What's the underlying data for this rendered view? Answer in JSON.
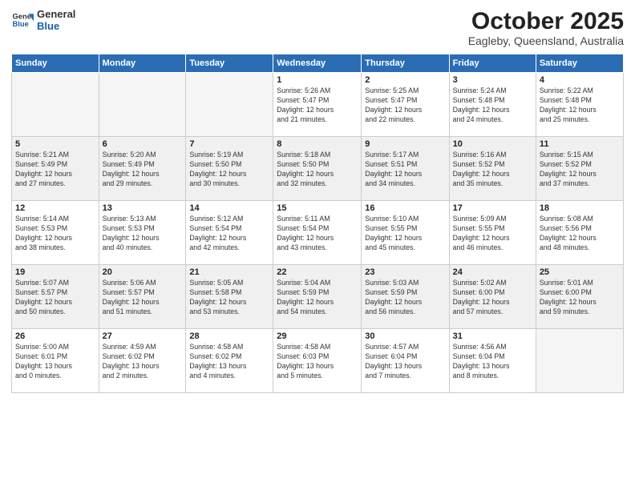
{
  "header": {
    "logo_line1": "General",
    "logo_line2": "Blue",
    "month": "October 2025",
    "location": "Eagleby, Queensland, Australia"
  },
  "weekdays": [
    "Sunday",
    "Monday",
    "Tuesday",
    "Wednesday",
    "Thursday",
    "Friday",
    "Saturday"
  ],
  "weeks": [
    [
      {
        "day": "",
        "info": ""
      },
      {
        "day": "",
        "info": ""
      },
      {
        "day": "",
        "info": ""
      },
      {
        "day": "1",
        "info": "Sunrise: 5:26 AM\nSunset: 5:47 PM\nDaylight: 12 hours\nand 21 minutes."
      },
      {
        "day": "2",
        "info": "Sunrise: 5:25 AM\nSunset: 5:47 PM\nDaylight: 12 hours\nand 22 minutes."
      },
      {
        "day": "3",
        "info": "Sunrise: 5:24 AM\nSunset: 5:48 PM\nDaylight: 12 hours\nand 24 minutes."
      },
      {
        "day": "4",
        "info": "Sunrise: 5:22 AM\nSunset: 5:48 PM\nDaylight: 12 hours\nand 25 minutes."
      }
    ],
    [
      {
        "day": "5",
        "info": "Sunrise: 5:21 AM\nSunset: 5:49 PM\nDaylight: 12 hours\nand 27 minutes."
      },
      {
        "day": "6",
        "info": "Sunrise: 5:20 AM\nSunset: 5:49 PM\nDaylight: 12 hours\nand 29 minutes."
      },
      {
        "day": "7",
        "info": "Sunrise: 5:19 AM\nSunset: 5:50 PM\nDaylight: 12 hours\nand 30 minutes."
      },
      {
        "day": "8",
        "info": "Sunrise: 5:18 AM\nSunset: 5:50 PM\nDaylight: 12 hours\nand 32 minutes."
      },
      {
        "day": "9",
        "info": "Sunrise: 5:17 AM\nSunset: 5:51 PM\nDaylight: 12 hours\nand 34 minutes."
      },
      {
        "day": "10",
        "info": "Sunrise: 5:16 AM\nSunset: 5:52 PM\nDaylight: 12 hours\nand 35 minutes."
      },
      {
        "day": "11",
        "info": "Sunrise: 5:15 AM\nSunset: 5:52 PM\nDaylight: 12 hours\nand 37 minutes."
      }
    ],
    [
      {
        "day": "12",
        "info": "Sunrise: 5:14 AM\nSunset: 5:53 PM\nDaylight: 12 hours\nand 38 minutes."
      },
      {
        "day": "13",
        "info": "Sunrise: 5:13 AM\nSunset: 5:53 PM\nDaylight: 12 hours\nand 40 minutes."
      },
      {
        "day": "14",
        "info": "Sunrise: 5:12 AM\nSunset: 5:54 PM\nDaylight: 12 hours\nand 42 minutes."
      },
      {
        "day": "15",
        "info": "Sunrise: 5:11 AM\nSunset: 5:54 PM\nDaylight: 12 hours\nand 43 minutes."
      },
      {
        "day": "16",
        "info": "Sunrise: 5:10 AM\nSunset: 5:55 PM\nDaylight: 12 hours\nand 45 minutes."
      },
      {
        "day": "17",
        "info": "Sunrise: 5:09 AM\nSunset: 5:55 PM\nDaylight: 12 hours\nand 46 minutes."
      },
      {
        "day": "18",
        "info": "Sunrise: 5:08 AM\nSunset: 5:56 PM\nDaylight: 12 hours\nand 48 minutes."
      }
    ],
    [
      {
        "day": "19",
        "info": "Sunrise: 5:07 AM\nSunset: 5:57 PM\nDaylight: 12 hours\nand 50 minutes."
      },
      {
        "day": "20",
        "info": "Sunrise: 5:06 AM\nSunset: 5:57 PM\nDaylight: 12 hours\nand 51 minutes."
      },
      {
        "day": "21",
        "info": "Sunrise: 5:05 AM\nSunset: 5:58 PM\nDaylight: 12 hours\nand 53 minutes."
      },
      {
        "day": "22",
        "info": "Sunrise: 5:04 AM\nSunset: 5:59 PM\nDaylight: 12 hours\nand 54 minutes."
      },
      {
        "day": "23",
        "info": "Sunrise: 5:03 AM\nSunset: 5:59 PM\nDaylight: 12 hours\nand 56 minutes."
      },
      {
        "day": "24",
        "info": "Sunrise: 5:02 AM\nSunset: 6:00 PM\nDaylight: 12 hours\nand 57 minutes."
      },
      {
        "day": "25",
        "info": "Sunrise: 5:01 AM\nSunset: 6:00 PM\nDaylight: 12 hours\nand 59 minutes."
      }
    ],
    [
      {
        "day": "26",
        "info": "Sunrise: 5:00 AM\nSunset: 6:01 PM\nDaylight: 13 hours\nand 0 minutes."
      },
      {
        "day": "27",
        "info": "Sunrise: 4:59 AM\nSunset: 6:02 PM\nDaylight: 13 hours\nand 2 minutes."
      },
      {
        "day": "28",
        "info": "Sunrise: 4:58 AM\nSunset: 6:02 PM\nDaylight: 13 hours\nand 4 minutes."
      },
      {
        "day": "29",
        "info": "Sunrise: 4:58 AM\nSunset: 6:03 PM\nDaylight: 13 hours\nand 5 minutes."
      },
      {
        "day": "30",
        "info": "Sunrise: 4:57 AM\nSunset: 6:04 PM\nDaylight: 13 hours\nand 7 minutes."
      },
      {
        "day": "31",
        "info": "Sunrise: 4:56 AM\nSunset: 6:04 PM\nDaylight: 13 hours\nand 8 minutes."
      },
      {
        "day": "",
        "info": ""
      }
    ]
  ]
}
